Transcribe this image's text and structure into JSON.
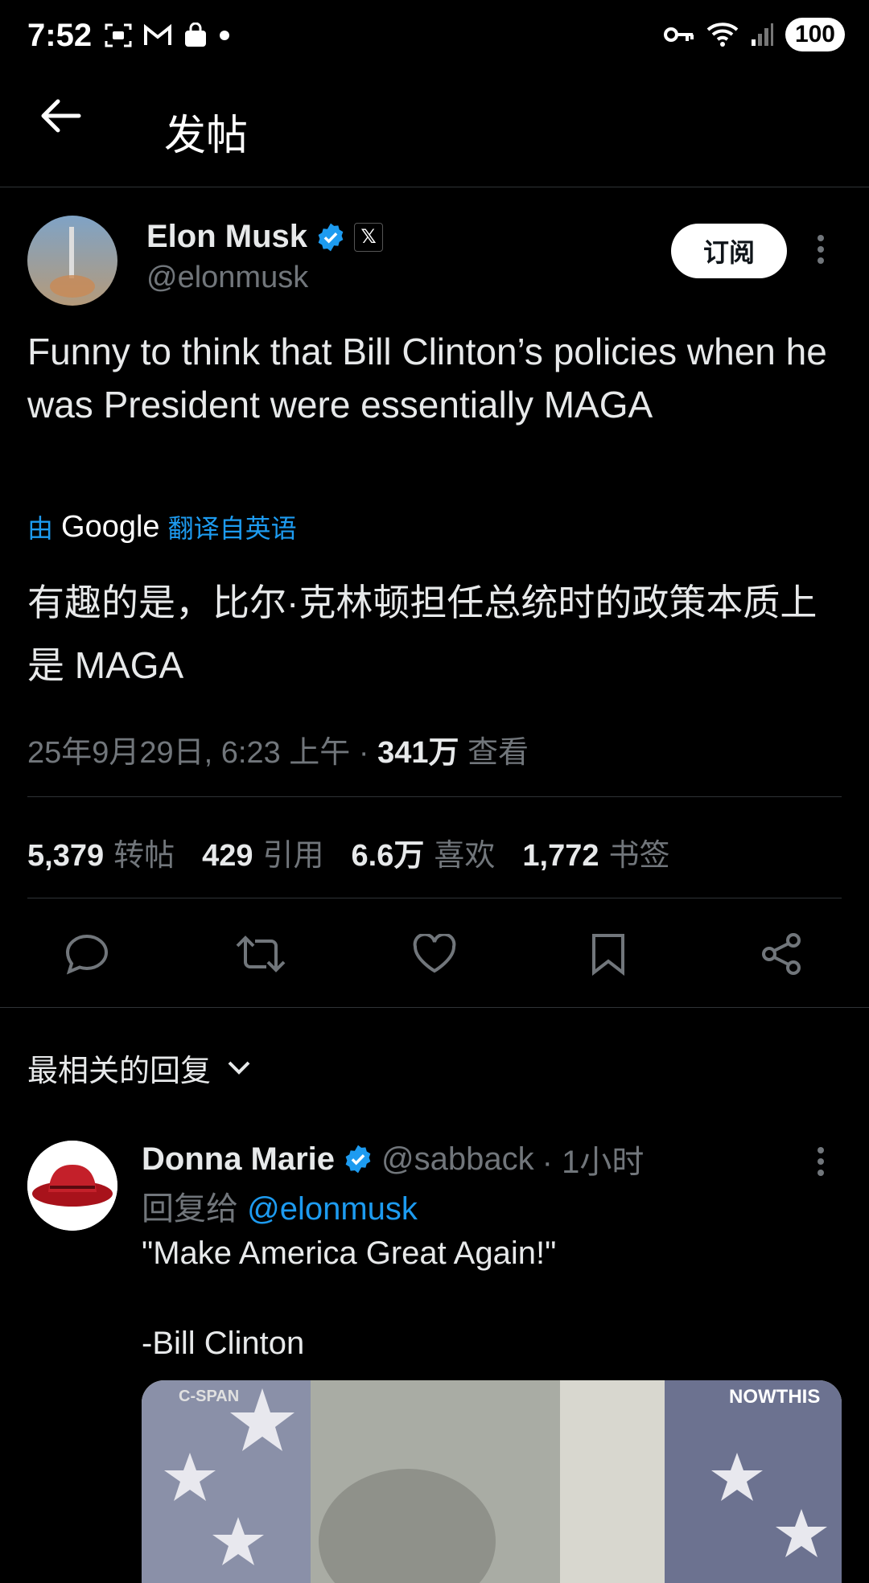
{
  "status_bar": {
    "time": "7:52",
    "battery": "100",
    "icons_left": [
      "screenshot-icon",
      "gmail-icon",
      "shopping-bag-icon",
      "dot-icon"
    ],
    "icons_right": [
      "key-icon",
      "wifi-icon",
      "signal-icon"
    ]
  },
  "header": {
    "title": "发帖"
  },
  "tweet": {
    "author_name": "Elon Musk",
    "author_handle": "@elonmusk",
    "subscribe_label": "订阅",
    "text": "Funny to think that Bill Clinton’s policies when he was President were essentially MAGA",
    "translate_prefix": "由",
    "translate_brand": "Google",
    "translate_suffix": "翻译自英语",
    "translated_text": "有趣的是，比尔·克林顿担任总统时的政策本质上是 MAGA",
    "timestamp": "25年9月29日, 6:23 上午 · ",
    "views_count": "341万",
    "views_label": " 查看",
    "stats": [
      {
        "count": "5,379",
        "label": "转帖"
      },
      {
        "count": "429",
        "label": "引用"
      },
      {
        "count": "6.6万",
        "label": "喜欢"
      },
      {
        "count": "1,772",
        "label": "书签"
      }
    ]
  },
  "replies": {
    "sort_label": "最相关的回复",
    "items": [
      {
        "name": "Donna Marie",
        "handle": "@sabback",
        "time": "· 1小时",
        "reply_prefix": "回复给",
        "reply_to": "@elonmusk",
        "text": "\"Make America Great Again!\"\n\n-Bill Clinton",
        "media_watermark_left": "C-SPAN",
        "media_watermark_right": "NOWTHIS"
      }
    ]
  },
  "colors": {
    "accent": "#1d9bf0",
    "background": "#000000",
    "secondary_text": "#71767b"
  }
}
